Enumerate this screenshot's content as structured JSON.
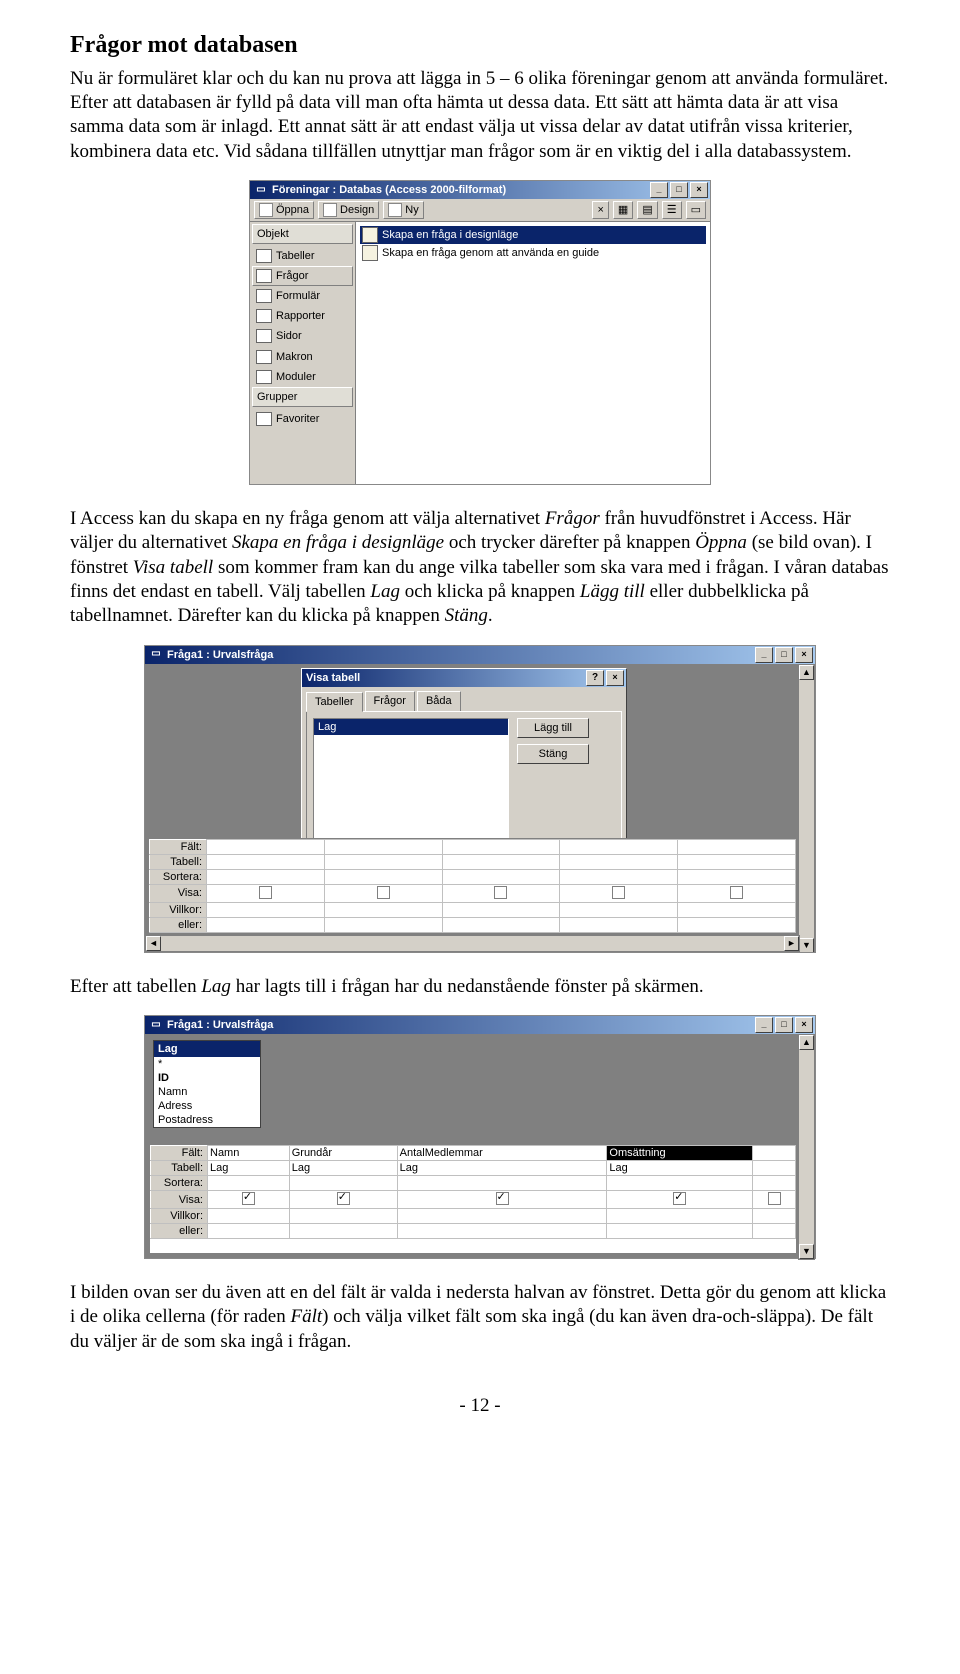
{
  "heading": "Frågor mot databasen",
  "para1": "Nu är formuläret klar och du kan nu prova att lägga in 5 – 6 olika föreningar genom att använda formuläret. Efter att databasen är fylld på data vill man ofta hämta ut dessa data. Ett sätt att hämta data är att visa samma data som är inlagd. Ett annat sätt är att endast välja ut vissa delar av datat utifrån vissa kriterier, kombinera data etc. Vid sådana tillfällen utnyttjar man frågor som är en viktig del i alla databassystem.",
  "para2_pre": "I Access kan du skapa en ny fråga genom att välja alternativet ",
  "para2_i1": "Frågor",
  "para2_mid1": " från huvudfönstret i Access. Här väljer du alternativet ",
  "para2_i2": "Skapa en fråga i designläge",
  "para2_mid2": " och trycker därefter på knappen ",
  "para2_i3": "Öppna",
  "para2_mid3": " (se bild ovan). I fönstret ",
  "para2_i4": "Visa tabell",
  "para2_mid4": " som kommer fram kan du ange vilka tabeller som ska vara med i frågan. I våran databas finns det endast en tabell. Välj tabellen ",
  "para2_i5": "Lag",
  "para2_mid5": " och klicka på knappen ",
  "para2_i6": "Lägg till",
  "para2_mid6": " eller dubbelklicka på tabellnamnet. Därefter kan du klicka på knappen ",
  "para2_i7": "Stäng",
  "para2_post": ".",
  "para3_pre": "Efter att tabellen ",
  "para3_i1": "Lag",
  "para3_post": " har lagts till i frågan har du nedanstående fönster på skärmen.",
  "para4_pre": "I bilden ovan ser du även att en del fält är valda i nedersta halvan av fönstret. Detta gör du genom att klicka i de olika cellerna (för raden ",
  "para4_i1": "Fält",
  "para4_post": ") och välja vilket fält som ska ingå (du kan även dra-och-släppa). De fält du väljer är de som ska ingå i frågan.",
  "page_num": "- 12 -",
  "shot1": {
    "title": "Föreningar : Databas (Access 2000-filformat)",
    "toolbar": {
      "open": "Öppna",
      "design": "Design",
      "new": "Ny"
    },
    "left_head_obj": "Objekt",
    "left_items": [
      "Tabeller",
      "Frågor",
      "Formulär",
      "Rapporter",
      "Sidor",
      "Makron",
      "Moduler"
    ],
    "left_head_grp": "Grupper",
    "left_fav": "Favoriter",
    "right": {
      "r1": "Skapa en fråga i designläge",
      "r2": "Skapa en fråga genom att använda en guide"
    }
  },
  "shot2": {
    "title": "Fråga1 : Urvalsfråga",
    "dlg_title": "Visa tabell",
    "tabs": [
      "Tabeller",
      "Frågor",
      "Båda"
    ],
    "item": "Lag",
    "btn_add": "Lägg till",
    "btn_close": "Stäng",
    "rows": [
      "Fält:",
      "Tabell:",
      "Sortera:",
      "Visa:",
      "Villkor:",
      "eller:"
    ]
  },
  "shot3": {
    "title": "Fråga1 : Urvalsfråga",
    "fieldlist_head": "Lag",
    "fields": [
      "*",
      "ID",
      "Namn",
      "Adress",
      "Postadress"
    ],
    "rows": [
      "Fält:",
      "Tabell:",
      "Sortera:",
      "Visa:",
      "Villkor:",
      "eller:"
    ],
    "grid": {
      "fields": [
        "Namn",
        "Grundår",
        "AntalMedlemmar",
        "Omsättning"
      ],
      "tables": [
        "Lag",
        "Lag",
        "Lag",
        "Lag"
      ]
    }
  }
}
